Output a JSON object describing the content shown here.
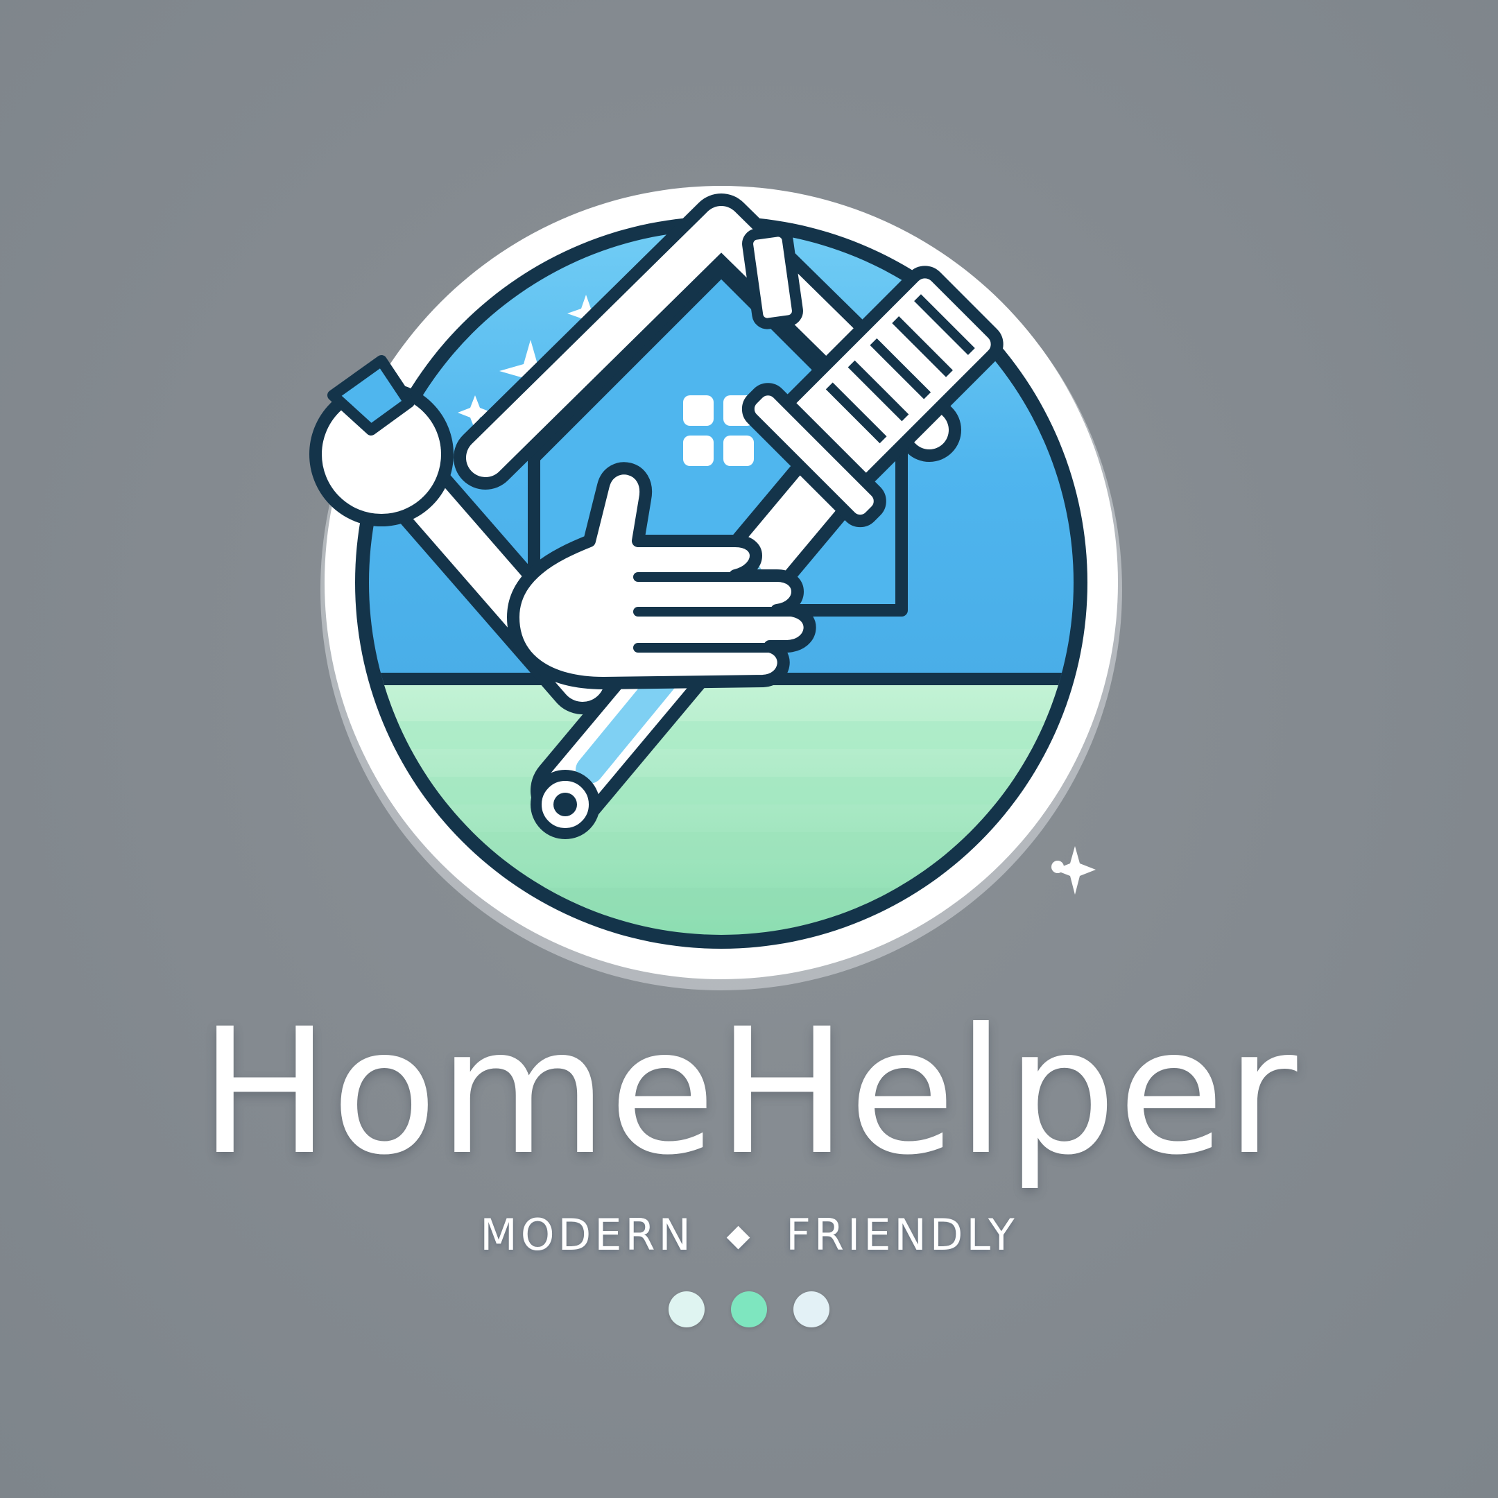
{
  "brand": {
    "name": "HomeHelper",
    "tagline_left": "MODERN",
    "tagline_separator": "◆",
    "tagline_right": "FRIENDLY"
  },
  "icons": {
    "emblem": "house-with-tools-icon",
    "house": "house-icon",
    "wrench": "wrench-icon",
    "brush": "brush-icon",
    "hand": "hand-icon",
    "sparkle": "sparkle-icon"
  },
  "colors": {
    "background": "#858b91",
    "sky_blue": "#4fb8ef",
    "sky_light": "#7fd3f6",
    "ground_green": "#8fe0b3",
    "ground_light": "#bff0d2",
    "outline": "#14344a",
    "white": "#ffffff",
    "dot_left": "#dff4f1",
    "dot_middle": "#7ee6bf",
    "dot_right": "#e3f1f6"
  }
}
